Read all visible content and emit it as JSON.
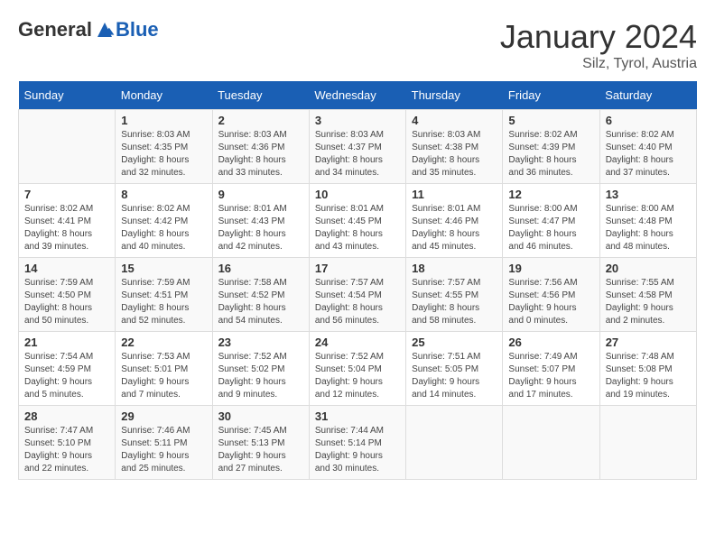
{
  "logo": {
    "general": "General",
    "blue": "Blue"
  },
  "header": {
    "month": "January 2024",
    "location": "Silz, Tyrol, Austria"
  },
  "days_of_week": [
    "Sunday",
    "Monday",
    "Tuesday",
    "Wednesday",
    "Thursday",
    "Friday",
    "Saturday"
  ],
  "weeks": [
    [
      {
        "day": "",
        "sunrise": "",
        "sunset": "",
        "daylight": ""
      },
      {
        "day": "1",
        "sunrise": "Sunrise: 8:03 AM",
        "sunset": "Sunset: 4:35 PM",
        "daylight": "Daylight: 8 hours and 32 minutes."
      },
      {
        "day": "2",
        "sunrise": "Sunrise: 8:03 AM",
        "sunset": "Sunset: 4:36 PM",
        "daylight": "Daylight: 8 hours and 33 minutes."
      },
      {
        "day": "3",
        "sunrise": "Sunrise: 8:03 AM",
        "sunset": "Sunset: 4:37 PM",
        "daylight": "Daylight: 8 hours and 34 minutes."
      },
      {
        "day": "4",
        "sunrise": "Sunrise: 8:03 AM",
        "sunset": "Sunset: 4:38 PM",
        "daylight": "Daylight: 8 hours and 35 minutes."
      },
      {
        "day": "5",
        "sunrise": "Sunrise: 8:02 AM",
        "sunset": "Sunset: 4:39 PM",
        "daylight": "Daylight: 8 hours and 36 minutes."
      },
      {
        "day": "6",
        "sunrise": "Sunrise: 8:02 AM",
        "sunset": "Sunset: 4:40 PM",
        "daylight": "Daylight: 8 hours and 37 minutes."
      }
    ],
    [
      {
        "day": "7",
        "sunrise": "Sunrise: 8:02 AM",
        "sunset": "Sunset: 4:41 PM",
        "daylight": "Daylight: 8 hours and 39 minutes."
      },
      {
        "day": "8",
        "sunrise": "Sunrise: 8:02 AM",
        "sunset": "Sunset: 4:42 PM",
        "daylight": "Daylight: 8 hours and 40 minutes."
      },
      {
        "day": "9",
        "sunrise": "Sunrise: 8:01 AM",
        "sunset": "Sunset: 4:43 PM",
        "daylight": "Daylight: 8 hours and 42 minutes."
      },
      {
        "day": "10",
        "sunrise": "Sunrise: 8:01 AM",
        "sunset": "Sunset: 4:45 PM",
        "daylight": "Daylight: 8 hours and 43 minutes."
      },
      {
        "day": "11",
        "sunrise": "Sunrise: 8:01 AM",
        "sunset": "Sunset: 4:46 PM",
        "daylight": "Daylight: 8 hours and 45 minutes."
      },
      {
        "day": "12",
        "sunrise": "Sunrise: 8:00 AM",
        "sunset": "Sunset: 4:47 PM",
        "daylight": "Daylight: 8 hours and 46 minutes."
      },
      {
        "day": "13",
        "sunrise": "Sunrise: 8:00 AM",
        "sunset": "Sunset: 4:48 PM",
        "daylight": "Daylight: 8 hours and 48 minutes."
      }
    ],
    [
      {
        "day": "14",
        "sunrise": "Sunrise: 7:59 AM",
        "sunset": "Sunset: 4:50 PM",
        "daylight": "Daylight: 8 hours and 50 minutes."
      },
      {
        "day": "15",
        "sunrise": "Sunrise: 7:59 AM",
        "sunset": "Sunset: 4:51 PM",
        "daylight": "Daylight: 8 hours and 52 minutes."
      },
      {
        "day": "16",
        "sunrise": "Sunrise: 7:58 AM",
        "sunset": "Sunset: 4:52 PM",
        "daylight": "Daylight: 8 hours and 54 minutes."
      },
      {
        "day": "17",
        "sunrise": "Sunrise: 7:57 AM",
        "sunset": "Sunset: 4:54 PM",
        "daylight": "Daylight: 8 hours and 56 minutes."
      },
      {
        "day": "18",
        "sunrise": "Sunrise: 7:57 AM",
        "sunset": "Sunset: 4:55 PM",
        "daylight": "Daylight: 8 hours and 58 minutes."
      },
      {
        "day": "19",
        "sunrise": "Sunrise: 7:56 AM",
        "sunset": "Sunset: 4:56 PM",
        "daylight": "Daylight: 9 hours and 0 minutes."
      },
      {
        "day": "20",
        "sunrise": "Sunrise: 7:55 AM",
        "sunset": "Sunset: 4:58 PM",
        "daylight": "Daylight: 9 hours and 2 minutes."
      }
    ],
    [
      {
        "day": "21",
        "sunrise": "Sunrise: 7:54 AM",
        "sunset": "Sunset: 4:59 PM",
        "daylight": "Daylight: 9 hours and 5 minutes."
      },
      {
        "day": "22",
        "sunrise": "Sunrise: 7:53 AM",
        "sunset": "Sunset: 5:01 PM",
        "daylight": "Daylight: 9 hours and 7 minutes."
      },
      {
        "day": "23",
        "sunrise": "Sunrise: 7:52 AM",
        "sunset": "Sunset: 5:02 PM",
        "daylight": "Daylight: 9 hours and 9 minutes."
      },
      {
        "day": "24",
        "sunrise": "Sunrise: 7:52 AM",
        "sunset": "Sunset: 5:04 PM",
        "daylight": "Daylight: 9 hours and 12 minutes."
      },
      {
        "day": "25",
        "sunrise": "Sunrise: 7:51 AM",
        "sunset": "Sunset: 5:05 PM",
        "daylight": "Daylight: 9 hours and 14 minutes."
      },
      {
        "day": "26",
        "sunrise": "Sunrise: 7:49 AM",
        "sunset": "Sunset: 5:07 PM",
        "daylight": "Daylight: 9 hours and 17 minutes."
      },
      {
        "day": "27",
        "sunrise": "Sunrise: 7:48 AM",
        "sunset": "Sunset: 5:08 PM",
        "daylight": "Daylight: 9 hours and 19 minutes."
      }
    ],
    [
      {
        "day": "28",
        "sunrise": "Sunrise: 7:47 AM",
        "sunset": "Sunset: 5:10 PM",
        "daylight": "Daylight: 9 hours and 22 minutes."
      },
      {
        "day": "29",
        "sunrise": "Sunrise: 7:46 AM",
        "sunset": "Sunset: 5:11 PM",
        "daylight": "Daylight: 9 hours and 25 minutes."
      },
      {
        "day": "30",
        "sunrise": "Sunrise: 7:45 AM",
        "sunset": "Sunset: 5:13 PM",
        "daylight": "Daylight: 9 hours and 27 minutes."
      },
      {
        "day": "31",
        "sunrise": "Sunrise: 7:44 AM",
        "sunset": "Sunset: 5:14 PM",
        "daylight": "Daylight: 9 hours and 30 minutes."
      },
      {
        "day": "",
        "sunrise": "",
        "sunset": "",
        "daylight": ""
      },
      {
        "day": "",
        "sunrise": "",
        "sunset": "",
        "daylight": ""
      },
      {
        "day": "",
        "sunrise": "",
        "sunset": "",
        "daylight": ""
      }
    ]
  ]
}
